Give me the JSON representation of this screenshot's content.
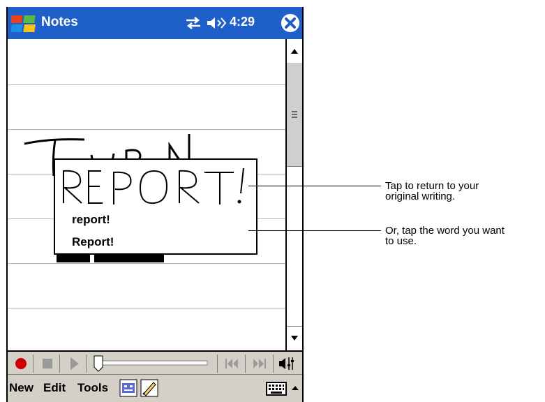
{
  "titlebar": {
    "app_title": "Notes",
    "clock": "4:29",
    "start_icon": "windows-flag-icon",
    "connectivity_icon": "connectivity-arrows-icon",
    "speaker_icon": "speaker-volume-icon",
    "close_icon": "close-circle-icon",
    "color": "#1f5fc9"
  },
  "popup": {
    "ink_preview": "REPORT!",
    "options": [
      "report!",
      "Report!"
    ]
  },
  "recording_toolbar": {
    "buttons": [
      "record-icon",
      "stop-icon",
      "play-icon",
      "volume-slider",
      "skip-back-icon",
      "skip-forward-icon",
      "speaker-settings-icon"
    ],
    "record_color": "#cc0000"
  },
  "menu_bar": {
    "new": "New",
    "edit": "Edit",
    "tools": "Tools",
    "mode_icons": [
      "recording-toolbar-icon",
      "pen-icon"
    ],
    "input_icons": [
      "keyboard-icon",
      "input-selector-arrow-icon"
    ]
  },
  "callouts": {
    "first": "Tap to return to your\noriginal writing.",
    "second": "Or, tap the word you want\nto use."
  }
}
